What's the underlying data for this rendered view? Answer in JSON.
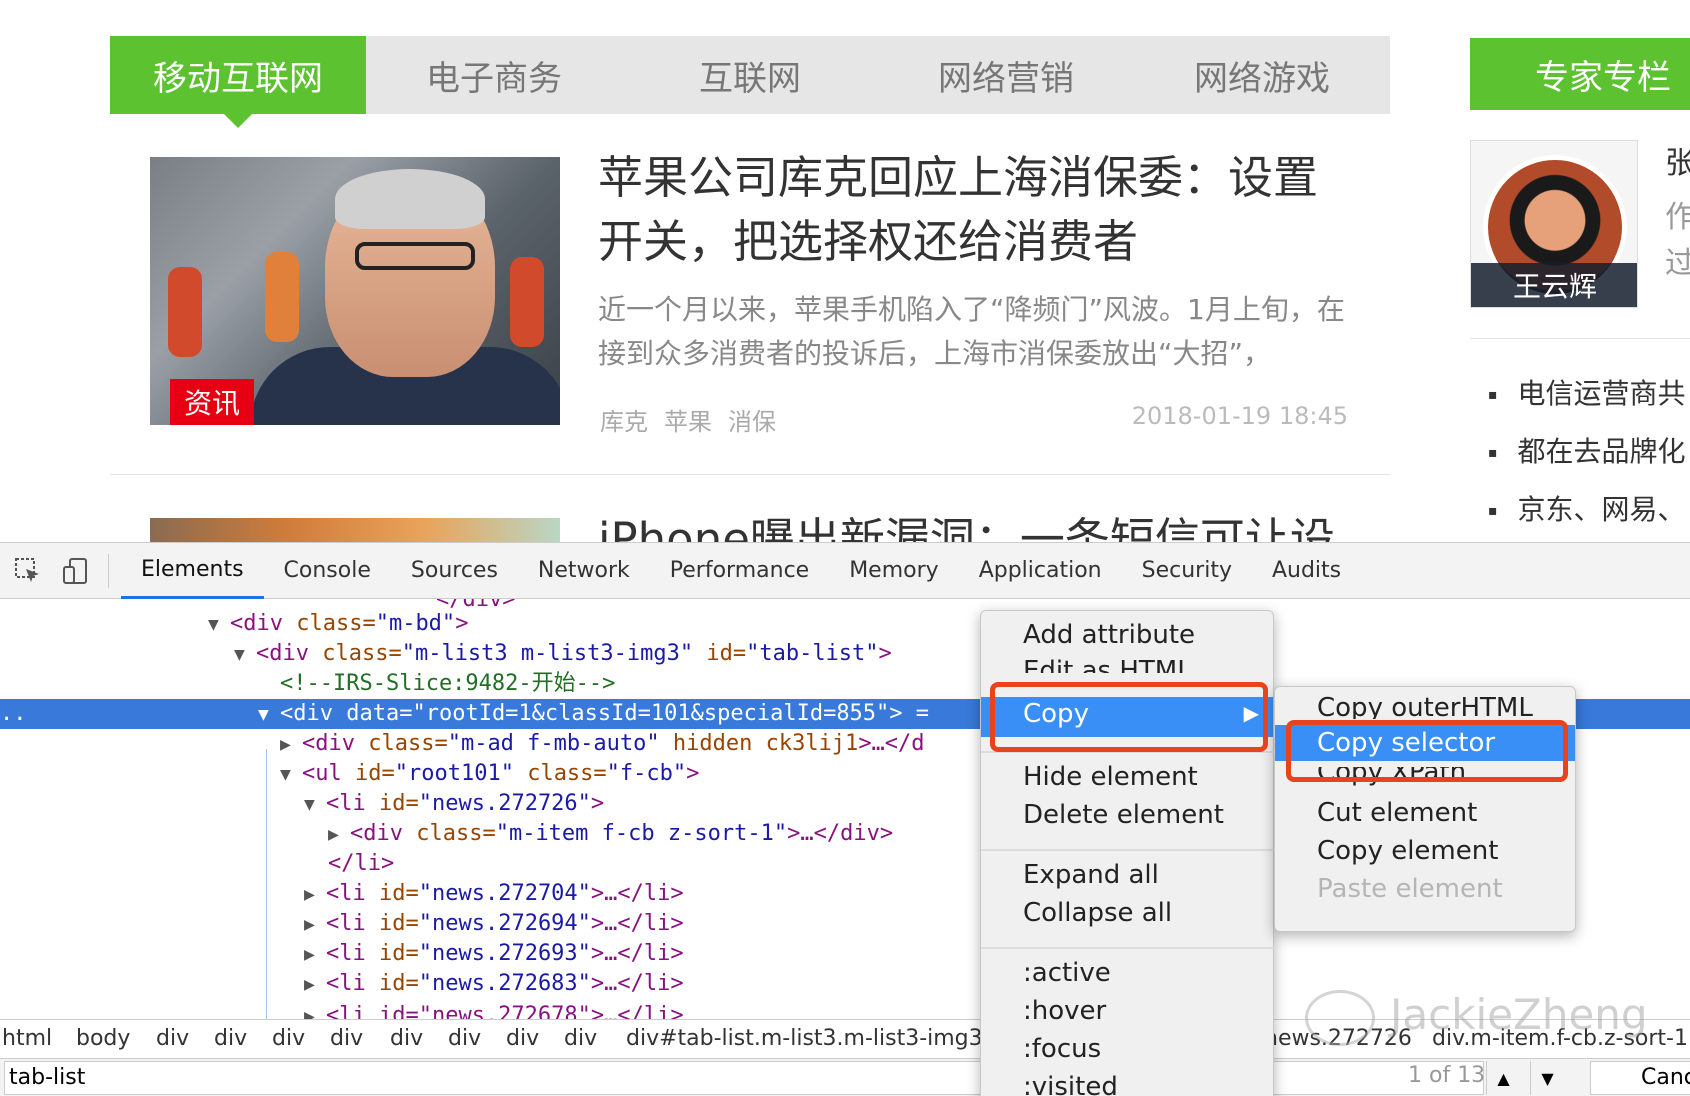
{
  "site": {
    "tabs": [
      "移动互联网",
      "电子商务",
      "互联网",
      "网络营销",
      "网络游戏"
    ],
    "article": {
      "badge": "资讯",
      "headline": "苹果公司库克回应上海消保委：设置开关，把选择权还给消费者",
      "summary": "近一个月以来，苹果手机陷入了“降频门”风波。1月上旬，在接到众多消费者的投诉后，上海市消保委放出“大招”，",
      "tags": [
        "库克",
        "苹果",
        "消保"
      ],
      "date": "2018-01-19 18:45"
    },
    "article2_headline": "iPhone曝出新漏洞：一条短信可让设",
    "sidebar": {
      "title": "专家专栏",
      "expert_name": "王云辉",
      "col_chars": [
        "张",
        "作",
        "过"
      ],
      "news": [
        "电信运营商共",
        "都在去品牌化",
        "京东、网易、"
      ]
    }
  },
  "devtools": {
    "tabs": [
      "Elements",
      "Console",
      "Sources",
      "Network",
      "Performance",
      "Memory",
      "Application",
      "Security",
      "Audits"
    ],
    "active_tab": "Elements",
    "dom": {
      "l0": "</div>",
      "l1_tag": "<div",
      "l1_attr": " class=",
      "l1_val": "\"m-bd\"",
      "l1_end": ">",
      "l2_tag": "<div",
      "l2_attr1": " class=",
      "l2_val1": "\"m-list3 m-list3-img3\"",
      "l2_attr2": " id=",
      "l2_val2": "\"tab-list\"",
      "l2_end": ">",
      "l3_comment": "<!--IRS-Slice:9482-开始-->",
      "l4_prefix": "..",
      "l4_tag": "<div",
      "l4_attr": " data=",
      "l4_val": "\"rootId=1&classId=101&specialId=855\"",
      "l4_end": "> =",
      "l5_tag": "<div",
      "l5_attr": " class=",
      "l5_val": "\"m-ad f-mb-auto\"",
      "l5_attr2": " hidden ck3lij1",
      "l5_end": ">…</d",
      "l6_tag": "<ul",
      "l6_attr1": " id=",
      "l6_val1": "\"root101\"",
      "l6_attr2": " class=",
      "l6_val2": "\"f-cb\"",
      "l6_end": ">",
      "l7_tag": "<li",
      "l7_attr": " id=",
      "l7_val": "\"news.272726\"",
      "l7_end": ">",
      "l8_tag": "<div",
      "l8_attr": " class=",
      "l8_val": "\"m-item f-cb z-sort-1\"",
      "l8_end": ">…</div>",
      "l9": "</li>",
      "li_items": [
        "\"news.272704\"",
        "\"news.272694\"",
        "\"news.272693\"",
        "\"news.272683\""
      ],
      "li_tag": "<li",
      "li_attr": " id=",
      "li_end": ">…</li>",
      "l14": "<li id=\"news.272678\">…</li>"
    },
    "breadcrumbs": [
      "html",
      "body",
      "div",
      "div",
      "div",
      "div",
      "div",
      "div",
      "div",
      "div",
      "div#tab-list.m-list3.m-list3-img3"
    ],
    "breadcrumbs_right": [
      "news.272726",
      "div.m-item.f-cb.z-sort-1"
    ],
    "search": {
      "value": "tab-list",
      "count": "1 of 13",
      "cancel": "Canc"
    }
  },
  "context_menu": {
    "items": [
      "Add attribute",
      "Edit as HTML",
      "Copy",
      "Hide element",
      "Delete element",
      "Expand all",
      "Collapse all",
      ":active",
      ":hover",
      ":focus",
      ":visited"
    ],
    "highlighted": "Copy",
    "submenu_arrow": "▶"
  },
  "copy_submenu": {
    "items": [
      "Copy outerHTML",
      "Copy selector",
      "Copy XPath",
      "Cut element",
      "Copy element",
      "Paste element"
    ],
    "highlighted": "Copy selector",
    "disabled": "Paste element"
  },
  "watermark": "JackieZheng",
  "colors": {
    "brand_green": "#5cc230",
    "selection_blue": "#3879d9",
    "menu_highlight": "#3a8ff7",
    "annotation_red": "#e8431d",
    "badge_red": "#e60012"
  }
}
